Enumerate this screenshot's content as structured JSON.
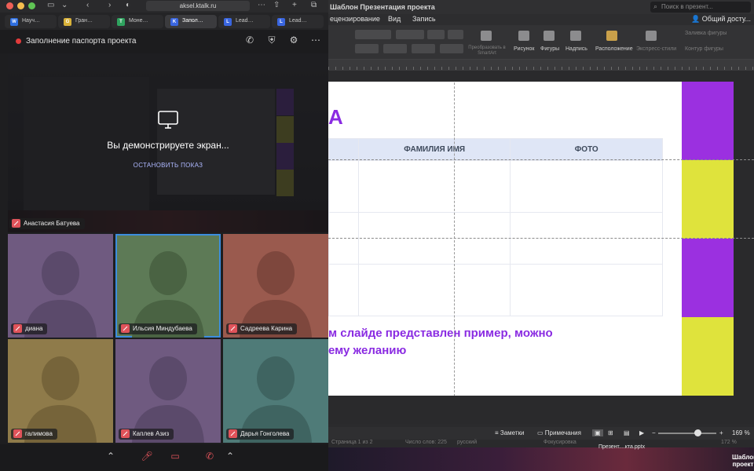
{
  "browser": {
    "address": "aksel.ktalk.ru",
    "tabs": [
      {
        "label": "Науч…",
        "favicon": "W",
        "color": "#2f6fe0"
      },
      {
        "label": "Гран…",
        "favicon": "G",
        "color": "#d9b23a"
      },
      {
        "label": "Моне…",
        "favicon": "T",
        "color": "#2fa35f"
      },
      {
        "label": "Запол…",
        "favicon": "K",
        "color": "#3a66e0"
      },
      {
        "label": "Lead…",
        "favicon": "L",
        "color": "#3a66e0"
      },
      {
        "label": "Lead…",
        "favicon": "L",
        "color": "#3a66e0"
      }
    ]
  },
  "meeting": {
    "title": "Заполнение паспорта проекта",
    "share_text": "Вы демонстрируете экран...",
    "stop_share": "ОСТАНОВИТЬ ПОКАЗ",
    "presenter": "Анастасия Батуева",
    "participants": [
      {
        "name": "диана",
        "bg": "#6f5a80",
        "fg": "#5b4a6b"
      },
      {
        "name": "Ильсия Миндубаева",
        "bg": "#5d7a56",
        "fg": "#4a6343"
      },
      {
        "name": "Садреева Карина",
        "bg": "#9a5a4e",
        "fg": "#7e473d"
      },
      {
        "name": "галимова",
        "bg": "#8f7b4a",
        "fg": "#76643a"
      },
      {
        "name": "Каплев Азиз",
        "bg": "#6f5a80",
        "fg": "#5b4a6b"
      },
      {
        "name": "Дарья Гонголева",
        "bg": "#4f7b78",
        "fg": "#3f6461"
      }
    ]
  },
  "powerpoint": {
    "window_title": "Шаблон Презентация проекта",
    "search_placeholder": "Поиск в презент...",
    "share_label": "Общий досту...",
    "menu": [
      "ецензирование",
      "Вид",
      "Запись"
    ],
    "ribbon": {
      "labels": [
        "Рисунок",
        "Фигуры",
        "Надпись",
        "Расположение",
        "Экспресс-стили"
      ],
      "dim_labels": [
        "Преобразовать в SmartArt",
        "Заливка фигуры",
        "Контур фигуры"
      ]
    },
    "ruler_numbers": [
      "5",
      "6",
      "7",
      "8",
      "9",
      "10"
    ],
    "slide": {
      "title_fragment": "А",
      "table_headers": [
        "",
        "ФАМИЛИЯ ИМЯ",
        "ФОТО",
        ""
      ],
      "caption_line1": "м слайде представлен пример, можно",
      "caption_line2": "ему желанию",
      "block_colors": [
        "#9b30e0",
        "#dfe33c",
        "#9b30e0",
        "#dfe33c"
      ]
    },
    "status": {
      "notes": "Заметки",
      "comments": "Примечания",
      "zoom": "169 %",
      "slide_info": "Страница 1 из 2",
      "words": "Число слов: 225",
      "language": "русский",
      "focus": "Фокусировка",
      "zoom_small": "172 %"
    },
    "desktop": {
      "file_label": "Презент....кта.pptx",
      "icon_label": "Шаблон проект"
    }
  }
}
